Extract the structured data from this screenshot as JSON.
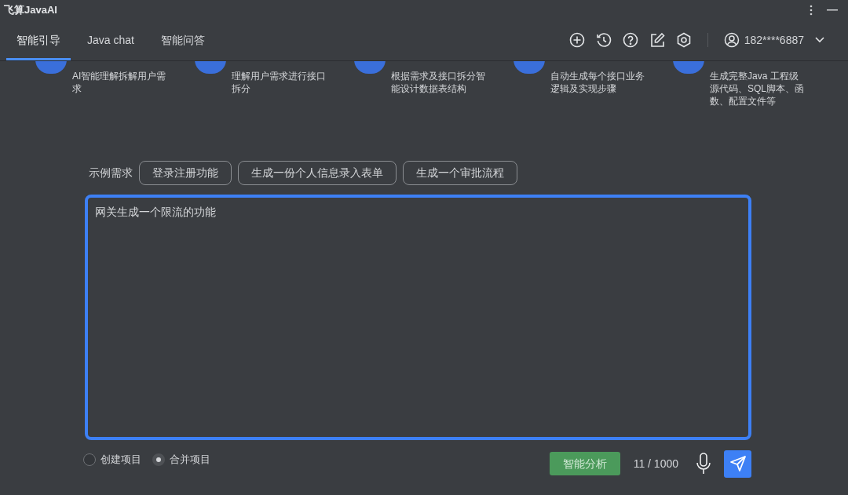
{
  "window": {
    "title": "飞算JavaAI"
  },
  "tabs": [
    {
      "label": "智能引导",
      "selected": true
    },
    {
      "label": "Java chat",
      "selected": false
    },
    {
      "label": "智能问答",
      "selected": false
    }
  ],
  "user": {
    "phone": "182****6887"
  },
  "steps": [
    {
      "text": "AI智能理解拆解用户需求"
    },
    {
      "text": "理解用户需求进行接口拆分"
    },
    {
      "text": "根据需求及接口拆分智能设计数据表结构"
    },
    {
      "text": "自动生成每个接口业务逻辑及实现步骤"
    },
    {
      "text": "生成完整Java 工程级源代码、SQL脚本、函数、配置文件等"
    }
  ],
  "examples": {
    "label": "示例需求",
    "items": [
      "登录注册功能",
      "生成一份个人信息录入表单",
      "生成一个审批流程"
    ]
  },
  "input": {
    "value": "网关生成一个限流的功能"
  },
  "modes": [
    {
      "label": "创建项目",
      "selected": false
    },
    {
      "label": "合并项目",
      "selected": true
    }
  ],
  "analyze_button": "智能分析",
  "counter": "11 / 1000"
}
